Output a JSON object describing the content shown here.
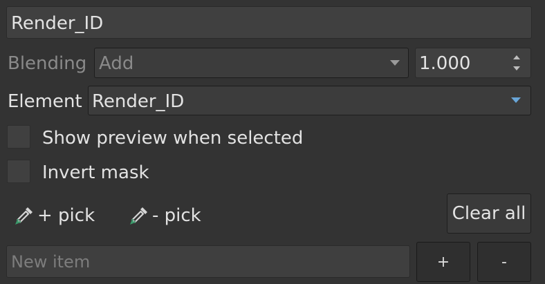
{
  "name_field": {
    "value": "Render_ID"
  },
  "blending": {
    "label": "Blending",
    "mode": "Add",
    "opacity": "1.000"
  },
  "element": {
    "label": "Element",
    "value": "Render_ID"
  },
  "options": {
    "show_preview_label": "Show preview when selected",
    "show_preview_checked": false,
    "invert_mask_label": "Invert mask",
    "invert_mask_checked": false
  },
  "pick": {
    "add_label": "+ pick",
    "remove_label": "- pick",
    "icon": "eyedropper-icon"
  },
  "clear_all_label": "Clear all",
  "new_item": {
    "placeholder": "New item",
    "add_label": "+",
    "remove_label": "-"
  },
  "colors": {
    "background": "#333333",
    "field": "#404040",
    "dropdown_accent": "#69a6d8",
    "eyedropper_accent": "#3a9a6a"
  }
}
